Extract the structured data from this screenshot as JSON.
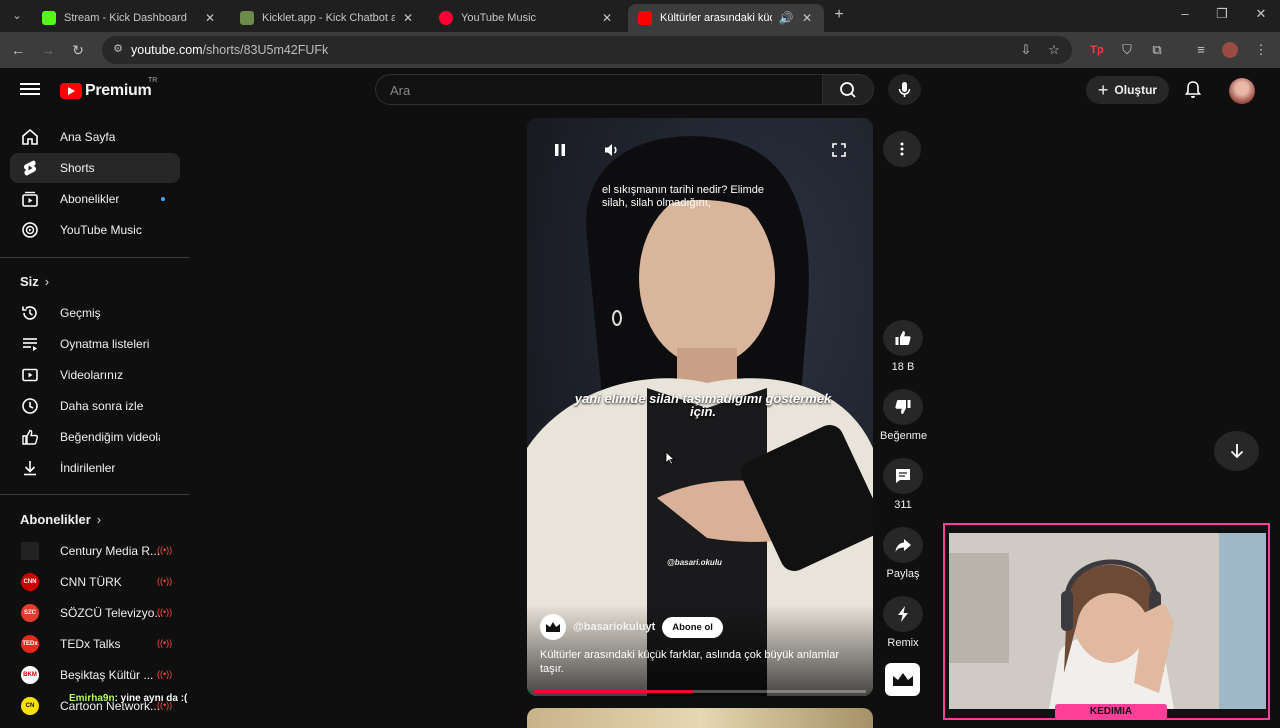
{
  "browser": {
    "tabs": [
      {
        "title": "Stream - Kick Dashboard",
        "favicon_color": "#53fc18",
        "active": false
      },
      {
        "title": "Kicklet.app - Kick Chatbot and (",
        "favicon_color": "#6b8a4c",
        "active": false
      },
      {
        "title": "YouTube Music",
        "favicon_color": "#ff0033",
        "active": false
      },
      {
        "title": "Kültürler arasındaki küçük fa",
        "favicon_color": "#ff0000",
        "active": true
      }
    ],
    "url_host": "youtube.com",
    "url_path": "/shorts/83U5m42FUFk"
  },
  "header": {
    "logo_text": "Premium",
    "country_code": "TR",
    "search_placeholder": "Ara",
    "create_label": "Oluştur"
  },
  "sidebar": {
    "main_items": [
      {
        "label": "Ana Sayfa",
        "icon": "home-icon"
      },
      {
        "label": "Shorts",
        "icon": "shorts-icon",
        "selected": true
      },
      {
        "label": "Abonelikler",
        "icon": "subscriptions-icon",
        "new_dot": true
      },
      {
        "label": "YouTube Music",
        "icon": "youtube-music-icon"
      }
    ],
    "you_title": "Siz",
    "you_items": [
      {
        "label": "Geçmiş",
        "icon": "history-icon"
      },
      {
        "label": "Oynatma listeleri",
        "icon": "playlists-icon"
      },
      {
        "label": "Videolarınız",
        "icon": "your-videos-icon"
      },
      {
        "label": "Daha sonra izle",
        "icon": "watch-later-icon"
      },
      {
        "label": "Beğendiğim videolar",
        "icon": "liked-videos-icon"
      },
      {
        "label": "İndirilenler",
        "icon": "downloads-icon"
      }
    ],
    "subs_title": "Abonelikler",
    "subscriptions": [
      {
        "label": "Century Media R...",
        "badge": "",
        "color": "#222222"
      },
      {
        "label": "CNN TÜRK",
        "badge": "CNN",
        "color": "#cc0000"
      },
      {
        "label": "SÖZCÜ Televizyo...",
        "badge": "SZC",
        "color": "#e33b2e"
      },
      {
        "label": "TEDx Talks",
        "badge": "TEDx",
        "color": "#e62b1e"
      },
      {
        "label": "Beşiktaş Kültür ...",
        "badge": "BKM",
        "color": "#ffffff"
      },
      {
        "label": "Cartoon Network...",
        "badge": "CN",
        "color": "#f5e000"
      }
    ]
  },
  "short": {
    "caption_top": "el sıkışmanın tarihi nedir?  Elimde silah, silah olmadığını,",
    "caption_mid": "yani elimde silah taşımadığımı göstermek için.",
    "watermark": "@basari.okulu",
    "channel": "@basariokuluyt",
    "subscribe_label": "Abone ol",
    "description": "Kültürler arasındaki küçük farklar, aslında çok büyük anlamlar taşır.",
    "progress": 0.48
  },
  "actions": {
    "likes": "18 B",
    "dislike_label": "Beğenme",
    "comments": "311",
    "share_label": "Paylaş",
    "remix_label": "Remix"
  },
  "overlay": {
    "cam_tag": "KEDIMIA",
    "chat_user": "Emirha9n",
    "chat_text": ": yine aynı da :("
  }
}
